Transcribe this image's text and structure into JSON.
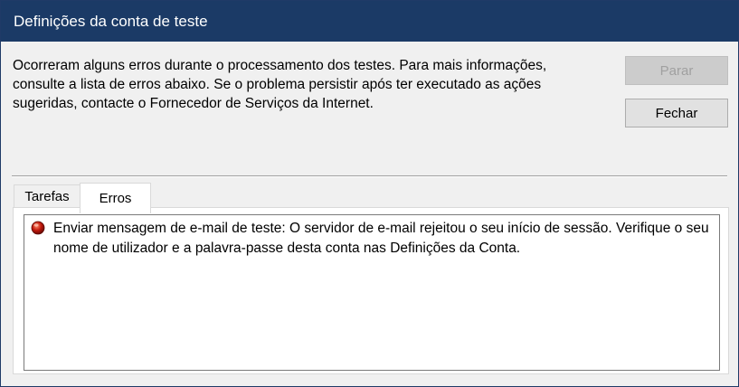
{
  "window": {
    "title": "Definições da conta de teste"
  },
  "message": "Ocorreram alguns erros durante o processamento dos testes. Para mais informações, consulte a lista de erros abaixo. Se o problema persistir após ter executado as ações sugeridas, contacte o Fornecedor de Serviços da Internet.",
  "buttons": {
    "stop": "Parar",
    "close": "Fechar"
  },
  "tabs": [
    {
      "label": "Tarefas"
    },
    {
      "label": "Erros"
    }
  ],
  "errors": [
    {
      "icon": "error-icon",
      "text": "Enviar mensagem de e-mail de teste: O servidor de e-mail rejeitou o seu início de sessão. Verifique o seu nome de utilizador e a palavra-passe desta conta nas Definições da Conta."
    }
  ]
}
